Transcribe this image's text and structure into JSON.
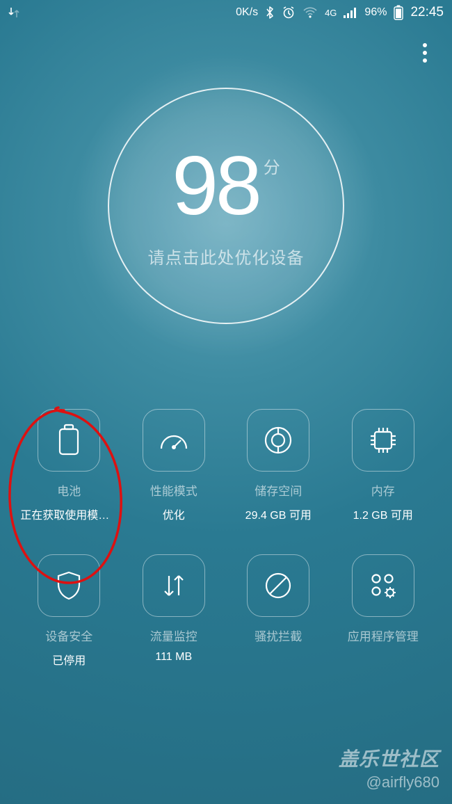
{
  "status": {
    "speed": "0K/s",
    "network_label": "4G",
    "battery_percent": "96%",
    "time": "22:45"
  },
  "score": {
    "value": "98",
    "unit": "分",
    "hint": "请点击此处优化设备"
  },
  "tiles": [
    {
      "title": "电池",
      "sub": "正在获取使用模式..."
    },
    {
      "title": "性能模式",
      "sub": "优化"
    },
    {
      "title": "储存空间",
      "sub": "29.4 GB 可用"
    },
    {
      "title": "内存",
      "sub": "1.2 GB 可用"
    },
    {
      "title": "设备安全",
      "sub": "已停用"
    },
    {
      "title": "流量监控",
      "sub": "111 MB"
    },
    {
      "title": "骚扰拦截",
      "sub": ""
    },
    {
      "title": "应用程序管理",
      "sub": ""
    }
  ],
  "watermark": {
    "title": "盖乐世社区",
    "user": "@airfly680"
  }
}
